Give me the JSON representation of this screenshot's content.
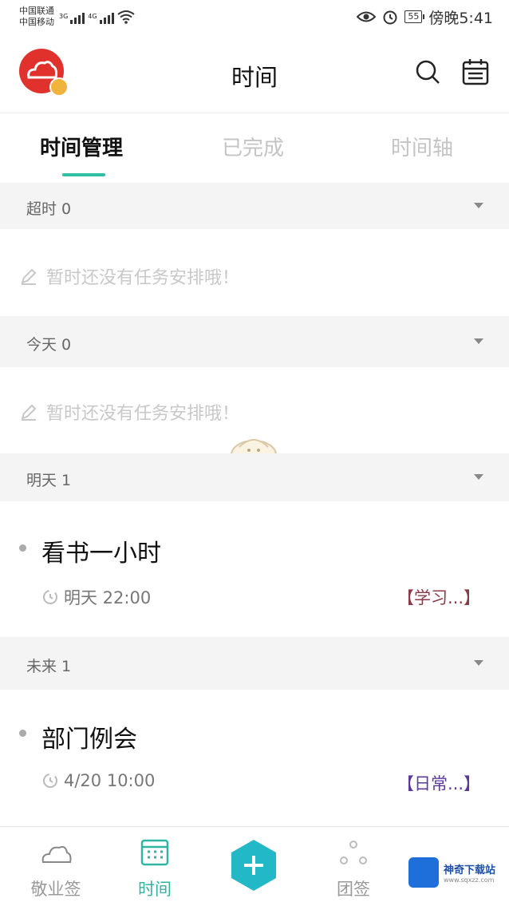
{
  "status_bar": {
    "carrier_1": "中国联通",
    "carrier_2": "中国移动",
    "net_1": "3G",
    "net_2": "4G",
    "battery": "55",
    "time": "傍晚5:41"
  },
  "header": {
    "title": "时间"
  },
  "tabs": [
    {
      "label": "时间管理"
    },
    {
      "label": "已完成"
    },
    {
      "label": "时间轴"
    }
  ],
  "sections": [
    {
      "label": "超时 0",
      "empty_text": "暂时还没有任务安排哦！"
    },
    {
      "label": "今天 0",
      "empty_text": "暂时还没有任务安排哦！"
    },
    {
      "label": "明天 1",
      "task": {
        "title": "看书一小时",
        "time": "明天 22:00",
        "tag": "【学习...】",
        "tag_color": "#8b3a4a"
      }
    },
    {
      "label": "未来 1",
      "task": {
        "title": "部门例会",
        "time": "4/20 10:00",
        "tag": "【日常...】",
        "tag_color": "#5b3b9a"
      }
    }
  ],
  "bottom_nav": [
    {
      "label": "敬业签"
    },
    {
      "label": "时间"
    },
    {
      "label": "团签"
    }
  ],
  "colors": {
    "accent": "#2fbfa5",
    "avatar": "#e0312d",
    "fab": "#22b8c8"
  },
  "watermark": {
    "main": "神奇下载站",
    "sub": "www.sqxzz.com"
  }
}
